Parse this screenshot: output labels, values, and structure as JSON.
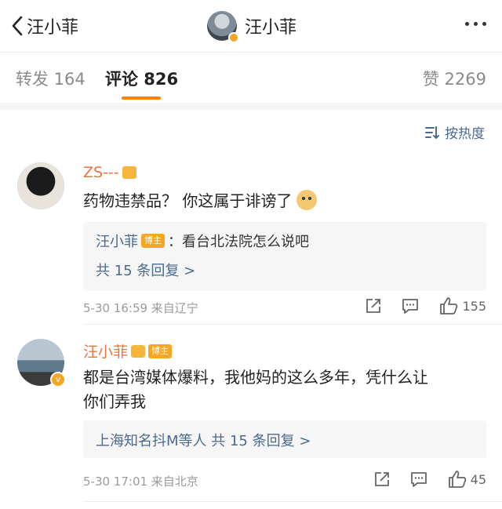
{
  "nav": {
    "back_name": "汪小菲",
    "title_name": "汪小菲"
  },
  "tabs": {
    "repost": "转发 164",
    "comments": "评论 826",
    "likes": "赞 2269",
    "accent_color": "#ff8200"
  },
  "sort_label": "按热度",
  "comments": [
    {
      "username": "ZS---",
      "text": "药物违禁品？  你这属于诽谤了",
      "reply_user": "汪小菲",
      "reply_tag": "博主",
      "reply_text": "：看台北法院怎么说吧",
      "reply_more": "共 15 条回复 >",
      "meta": "5-30 16:59  来自辽宁",
      "likes": "155"
    },
    {
      "username": "汪小菲",
      "tag": "博主",
      "text_line1": "都是台湾媒体爆料，我他妈的这么多年，凭什么让",
      "text_line2": "你们弄我",
      "reply_summary": "上海知名抖M等人  共 15 条回复 >",
      "meta": "5-30 17:01  来自北京",
      "likes": "45"
    }
  ],
  "colors": {
    "name_orange": "#eb7340",
    "link_blue": "#4a6a8f"
  }
}
